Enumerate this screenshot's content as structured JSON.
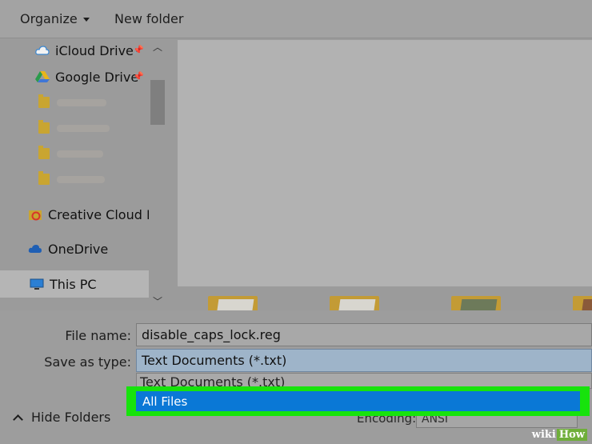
{
  "toolbar": {
    "organize_label": "Organize",
    "new_folder_label": "New folder"
  },
  "nav": {
    "icloud_label": "iCloud Drive",
    "google_drive_label": "Google Drive",
    "creative_cloud_label": "Creative Cloud Fil",
    "onedrive_label": "OneDrive",
    "this_pc_label": "This PC"
  },
  "form": {
    "file_name_label": "File name:",
    "file_name_value": "disable_caps_lock.reg",
    "save_as_type_label": "Save as type:",
    "save_as_type_value": "Text Documents (*.txt)",
    "dropdown_option_text": "Text Documents (*.txt)",
    "dropdown_option_all": "All Files",
    "encoding_label": "Encoding:",
    "encoding_value": "ANSI"
  },
  "footer": {
    "hide_folders_label": "Hide Folders"
  },
  "colors": {
    "highlight": "#17e30c",
    "selected_option": "#0a78d6"
  },
  "watermark": {
    "prefix": "wiki",
    "suffix": "How"
  }
}
